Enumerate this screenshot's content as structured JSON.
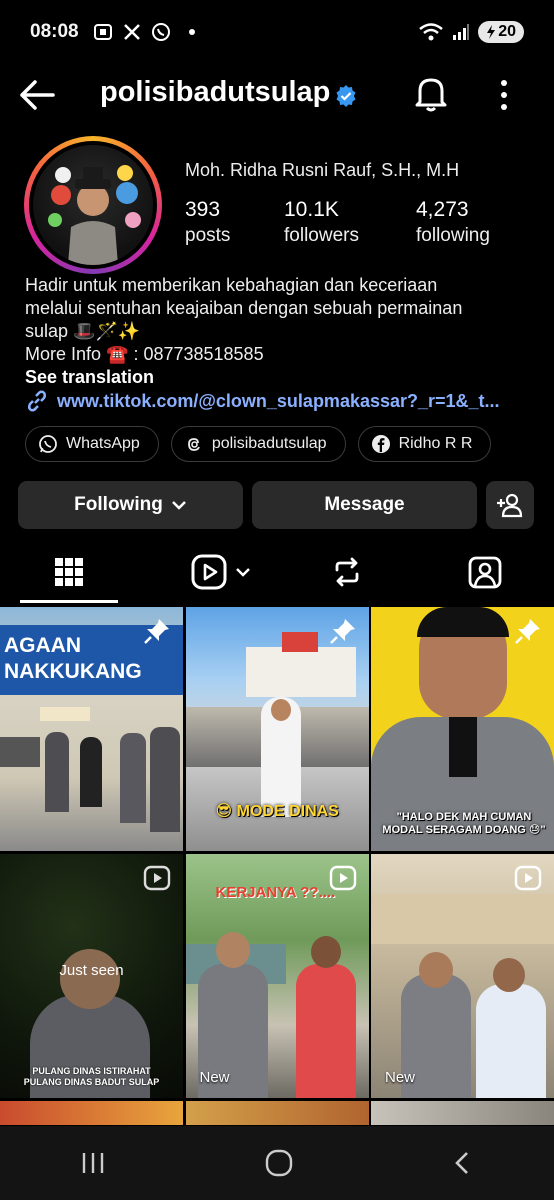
{
  "status": {
    "time": "08:08",
    "battery": "20"
  },
  "header": {
    "username": "polisibadutsulap",
    "back_icon": "arrow-left-icon",
    "verified_icon": "verified-badge-icon",
    "bell_icon": "bell-icon",
    "more_icon": "more-vertical-icon"
  },
  "profile": {
    "full_name": "Moh. Ridha Rusni Rauf, S.H., M.H",
    "stats": [
      {
        "num": "393",
        "label": "posts"
      },
      {
        "num": "10.1K",
        "label": "followers"
      },
      {
        "num": "4,273",
        "label": "following"
      }
    ],
    "bio_line1": "Hadir untuk memberikan kebahagian dan keceriaan",
    "bio_line2": "melalui sentuhan keajaiban dengan sebuah permainan",
    "bio_line3": "sulap 🎩🪄✨",
    "bio_line4": "More Info ☎️ : 087738518585",
    "see_translation": "See translation",
    "link": "www.tiktok.com/@clown_sulapmakassar?_r=1&_t..."
  },
  "chips": [
    {
      "label": "WhatsApp",
      "icon": "whatsapp-icon"
    },
    {
      "label": "polisibadutsulap",
      "icon": "threads-icon"
    },
    {
      "label": "Ridho R R",
      "icon": "facebook-icon"
    }
  ],
  "actions": {
    "following": "Following",
    "message": "Message",
    "add_user_icon": "add-user-icon"
  },
  "tabs": [
    "grid-icon",
    "reels-icon",
    "reposts-icon",
    "tagged-icon"
  ],
  "posts": [
    {
      "overlay": "AGAAN\nNAKKUKANG",
      "pinned": true
    },
    {
      "overlay": "😎 MODE DINAS",
      "pinned": true
    },
    {
      "overlay": "\"HALO DEK MAH CUMAN MODAL SERAGAM DOANG 😓\"",
      "pinned": true
    },
    {
      "overlay": "Just seen",
      "caption": "PULANG DINAS ISTIRAHAT\nPULANG DINAS BADUT SULAP",
      "reel": true
    },
    {
      "overlay": "KERJANYA ??....",
      "badge": "New",
      "reel": true
    },
    {
      "badge": "New",
      "reel": true
    }
  ],
  "colors": {
    "background": "#000000",
    "link": "#8ab0ff",
    "button": "#2a2a2a",
    "verified": "#3897f0"
  }
}
